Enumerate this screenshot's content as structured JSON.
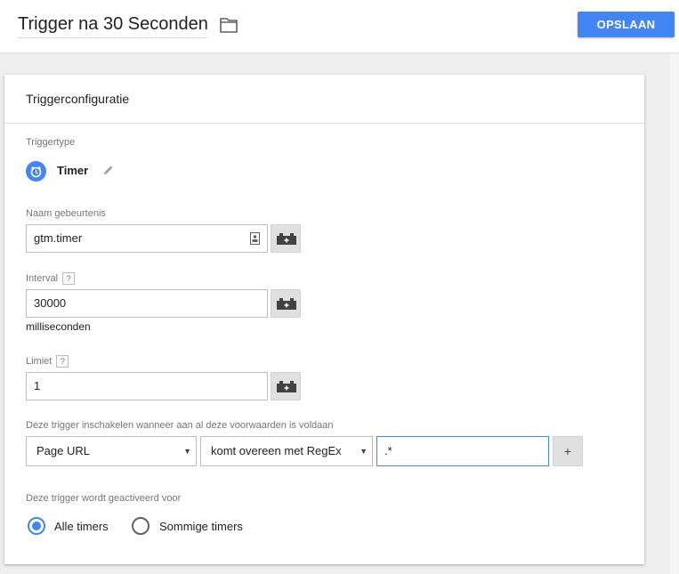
{
  "header": {
    "title": "Trigger na 30 Seconden",
    "save_label": "OPSLAAN",
    "folder_icon": "folder-icon"
  },
  "card": {
    "title": "Triggerconfiguratie",
    "trigger_type": {
      "label": "Triggertype",
      "name": "Timer",
      "icon": "alarm-clock-icon",
      "edit_icon": "pencil-icon"
    },
    "event_name": {
      "label": "Naam gebeurtenis",
      "value": "gtm.timer"
    },
    "interval": {
      "label": "Interval",
      "help": "?",
      "value": "30000",
      "unit": "milliseconden"
    },
    "limit": {
      "label": "Limiet",
      "help": "?",
      "value": "1"
    },
    "conditions": {
      "label": "Deze trigger inschakelen wanneer aan al deze voorwaarden is voldaan",
      "variable": "Page URL",
      "operator": "komt overeen met RegEx",
      "value": ".*",
      "add_label": "+"
    },
    "fires_on": {
      "label": "Deze trigger wordt geactiveerd voor",
      "options": [
        {
          "label": "Alle timers",
          "selected": true
        },
        {
          "label": "Sommige timers",
          "selected": false
        }
      ]
    }
  },
  "colors": {
    "accent": "#4285f4",
    "background": "#eeeeee"
  }
}
